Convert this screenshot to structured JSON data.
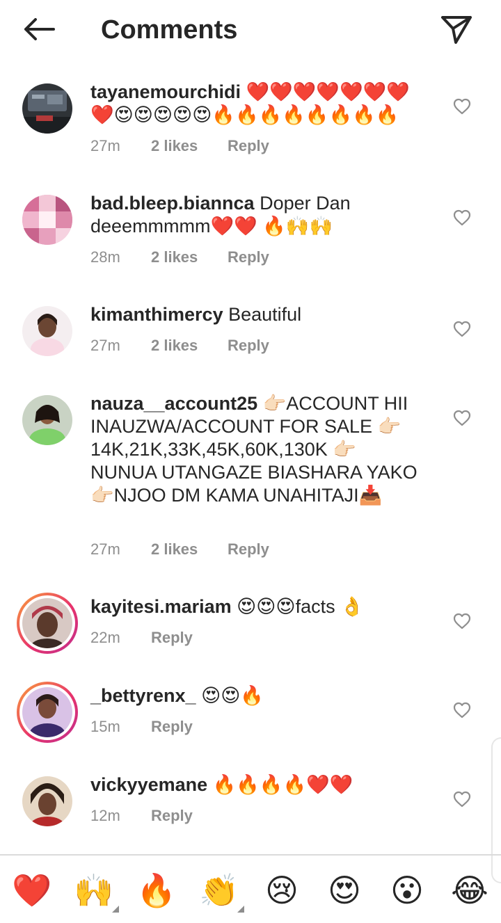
{
  "header": {
    "title": "Comments"
  },
  "comments": [
    {
      "username": "tayanemourchidi",
      "text": " ❤️❤️❤️❤️❤️❤️❤️❤️😍😍😍😍😍🔥🔥🔥🔥🔥🔥🔥🔥",
      "time": "27m",
      "likes": "2 likes",
      "reply": "Reply"
    },
    {
      "username": "bad.bleep.biannca",
      "text": " Doper Dan deeemmmmm❤️❤️ 🔥🙌🙌",
      "time": "28m",
      "likes": "2 likes",
      "reply": "Reply"
    },
    {
      "username": "kimanthimercy",
      "text": " Beautiful",
      "time": "27m",
      "likes": "2 likes",
      "reply": "Reply"
    },
    {
      "username": "nauza__account25",
      "text": " 👉🏻ACCOUNT HII INAUZWA/ACCOUNT FOR SALE 👉🏻14K,21K,33K,45K,60K,130K 👉🏻NUNUA UTANGAZE BIASHARA YAKO 👉🏻NJOO DM KAMA UNAHITAJI📥",
      "time": "27m",
      "likes": "2 likes",
      "reply": "Reply"
    },
    {
      "username": "kayitesi.mariam",
      "text": " 😍😍😍facts 👌",
      "time": "22m",
      "reply": "Reply"
    },
    {
      "username": "_bettyrenx_",
      "text": " 😍😍🔥",
      "time": "15m",
      "reply": "Reply"
    },
    {
      "username": "vickyyemane",
      "text": " 🔥🔥🔥🔥❤️❤️",
      "time": "12m",
      "reply": "Reply"
    }
  ],
  "emoji_bar": [
    "❤️",
    "🙌",
    "🔥",
    "👏",
    "😢",
    "😍",
    "😮",
    "😂"
  ],
  "colors": {
    "text": "#262626",
    "secondary": "#8e8e8e",
    "divider": "#dbdbdb",
    "story_ring_start": "#f9a13a",
    "story_ring_end": "#c02f8f"
  },
  "icons": {
    "back": "arrow-left-icon",
    "send": "paper-plane-icon",
    "like": "heart-outline-icon"
  }
}
